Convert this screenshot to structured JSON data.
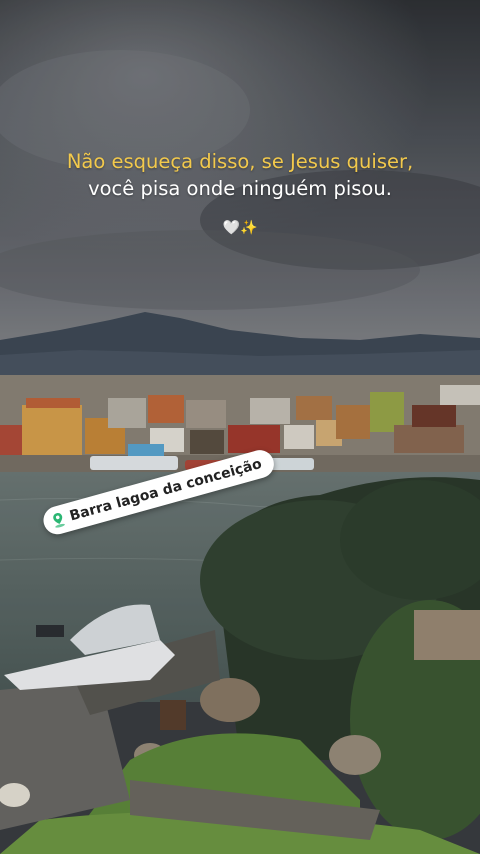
{
  "caption": {
    "line1": "Não esqueça disso, se Jesus quiser,",
    "line2": "você pisa onde ninguém pisou.",
    "emoji": "🤍✨"
  },
  "location_sticker": {
    "label": "Barra lagoa da conceição",
    "icon": "map-pin-icon"
  },
  "colors": {
    "caption_highlight": "#f2c94c",
    "caption_text": "#ffffff",
    "sticker_bg": "#ffffff",
    "pin": "#2bb673"
  }
}
